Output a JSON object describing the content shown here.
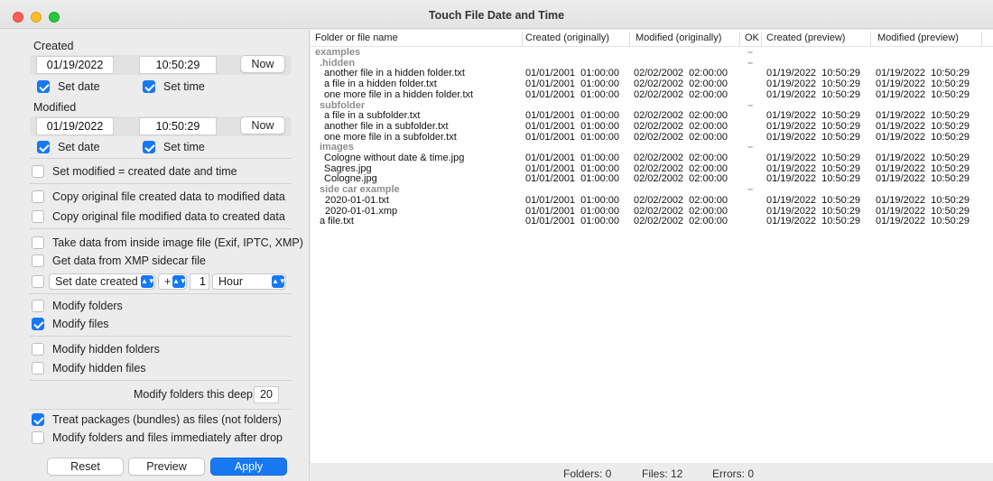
{
  "window": {
    "title": "Touch File Date and Time"
  },
  "created": {
    "label": "Created",
    "date": "01/19/2022",
    "time": "10:50:29",
    "now_label": "Now",
    "set_date_label": "Set date",
    "set_time_label": "Set time"
  },
  "modified": {
    "label": "Modified",
    "date": "01/19/2022",
    "time": "10:50:29",
    "now_label": "Now",
    "set_date_label": "Set date",
    "set_time_label": "Set time"
  },
  "options": {
    "set_modified_equal": "Set modified = created date and time",
    "copy_created_to_modified": "Copy original file created data to modified data",
    "copy_modified_to_created": "Copy original file modified data to created data",
    "take_from_image": "Take data from inside image file (Exif, IPTC, XMP)",
    "get_from_xmp": "Get data from XMP sidecar file",
    "shift_field": "Set date created",
    "shift_op": "+",
    "shift_amount": "1",
    "shift_unit": "Hour",
    "modify_folders": "Modify folders",
    "modify_files": "Modify files",
    "modify_hidden_folders": "Modify hidden folders",
    "modify_hidden_files": "Modify hidden files",
    "deep_label": "Modify folders this deep:",
    "deep_value": "20",
    "treat_packages": "Treat packages (bundles) as files (not folders)",
    "modify_after_drop": "Modify folders and files immediately after drop"
  },
  "buttons": {
    "reset": "Reset",
    "preview": "Preview",
    "apply": "Apply"
  },
  "table": {
    "columns": [
      "Folder or file name",
      "Created (originally)",
      "Modified (originally)",
      "OK",
      "Created (preview)",
      "Modified (preview)"
    ],
    "rows": [
      {
        "name": "examples",
        "group": true,
        "ok": "–"
      },
      {
        "name": ".hidden",
        "group": true,
        "ok": "–"
      },
      {
        "name": "another file in a hidden folder.txt",
        "c_orig": "01/01/2001  01:00:00",
        "m_orig": "02/02/2002  02:00:00",
        "c_prev": "01/19/2022  10:50:29",
        "m_prev": "01/19/2022  10:50:29"
      },
      {
        "name": "a file in a hidden folder.txt",
        "c_orig": "01/01/2001  01:00:00",
        "m_orig": "02/02/2002  02:00:00",
        "c_prev": "01/19/2022  10:50:29",
        "m_prev": "01/19/2022  10:50:29"
      },
      {
        "name": "one more file in a hidden folder.txt",
        "c_orig": "01/01/2001  01:00:00",
        "m_orig": "02/02/2002  02:00:00",
        "c_prev": "01/19/2022  10:50:29",
        "m_prev": "01/19/2022  10:50:29"
      },
      {
        "name": "subfolder",
        "group": true,
        "ok": "–"
      },
      {
        "name": "a file in a subfolder.txt",
        "c_orig": "01/01/2001  01:00:00",
        "m_orig": "02/02/2002  02:00:00",
        "c_prev": "01/19/2022  10:50:29",
        "m_prev": "01/19/2022  10:50:29"
      },
      {
        "name": "another file in a subfolder.txt",
        "c_orig": "01/01/2001  01:00:00",
        "m_orig": "02/02/2002  02:00:00",
        "c_prev": "01/19/2022  10:50:29",
        "m_prev": "01/19/2022  10:50:29"
      },
      {
        "name": "one more file in a subfolder.txt",
        "c_orig": "01/01/2001  01:00:00",
        "m_orig": "02/02/2002  02:00:00",
        "c_prev": "01/19/2022  10:50:29",
        "m_prev": "01/19/2022  10:50:29"
      },
      {
        "name": "images",
        "group": true,
        "ok": "–"
      },
      {
        "name": "Cologne without date & time.jpg",
        "c_orig": "01/01/2001  01:00:00",
        "m_orig": "02/02/2002  02:00:00",
        "c_prev": "01/19/2022  10:50:29",
        "m_prev": "01/19/2022  10:50:29"
      },
      {
        "name": "Sagres.jpg",
        "c_orig": "01/01/2001  01:00:00",
        "m_orig": "02/02/2002  02:00:00",
        "c_prev": "01/19/2022  10:50:29",
        "m_prev": "01/19/2022  10:50:29"
      },
      {
        "name": "Cologne.jpg",
        "c_orig": "01/01/2001  01:00:00",
        "m_orig": "02/02/2002  02:00:00",
        "c_prev": "01/19/2022  10:50:29",
        "m_prev": "01/19/2022  10:50:29"
      },
      {
        "name": "side car example",
        "group": true,
        "ok": "–"
      },
      {
        "name": "2020-01-01.txt",
        "c_orig": "01/01/2001  01:00:00",
        "m_orig": "02/02/2002  02:00:00",
        "c_prev": "01/19/2022  10:50:29",
        "m_prev": "01/19/2022  10:50:29"
      },
      {
        "name": "2020-01-01.xmp",
        "c_orig": "01/01/2001  01:00:00",
        "m_orig": "02/02/2002  02:00:00",
        "c_prev": "01/19/2022  10:50:29",
        "m_prev": "01/19/2022  10:50:29"
      },
      {
        "name": "a file.txt",
        "c_orig": "01/01/2001  01:00:00",
        "m_orig": "02/02/2002  02:00:00",
        "c_prev": "01/19/2022  10:50:29",
        "m_prev": "01/19/2022  10:50:29"
      }
    ]
  },
  "status": {
    "folders": "Folders:  0",
    "files": "Files:  12",
    "errors": "Errors:  0"
  },
  "colors": {
    "accent": "#1778f2",
    "group_text": "#8e8e8e"
  }
}
